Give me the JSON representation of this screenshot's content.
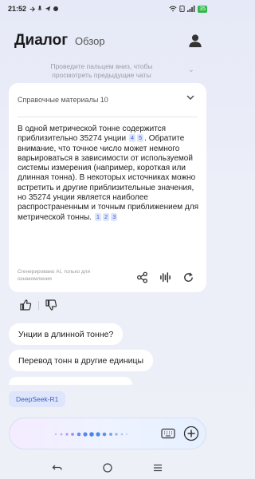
{
  "status": {
    "time": "21:52",
    "battery": "35"
  },
  "header": {
    "title": "Диалог",
    "tab_overview": "Обзор"
  },
  "pull_hint": "Проведите пальцем вниз, чтобы просмотреть предыдущие чаты",
  "card": {
    "references_label": "Справочные материалы 10",
    "body_part1": "В одной метрической тонне содержится приблизительно 35274 унции",
    "cites_a": [
      "4",
      "5"
    ],
    "body_part2": ". Обратите внимание, что точное число может немного варьироваться в зависимости от используемой системы измерения (например, короткая или длинная тонна). В некоторых источниках можно встретить и другие приблизительные значения, но 35274 унции является наиболее распространенным и точным приближением для метрической тонны.",
    "cites_b": [
      "1",
      "2",
      "3"
    ],
    "generated_note": "Сгенерировано AI, только для ознакомления"
  },
  "suggestions": [
    "Унции в длинной тонне?",
    "Перевод тонн в другие единицы"
  ],
  "model_chip": "DeepSeek-R1",
  "colors": {
    "accent": "#3f5fc9",
    "cite_bg": "#dde6fb",
    "background": "#e9ebf7"
  }
}
